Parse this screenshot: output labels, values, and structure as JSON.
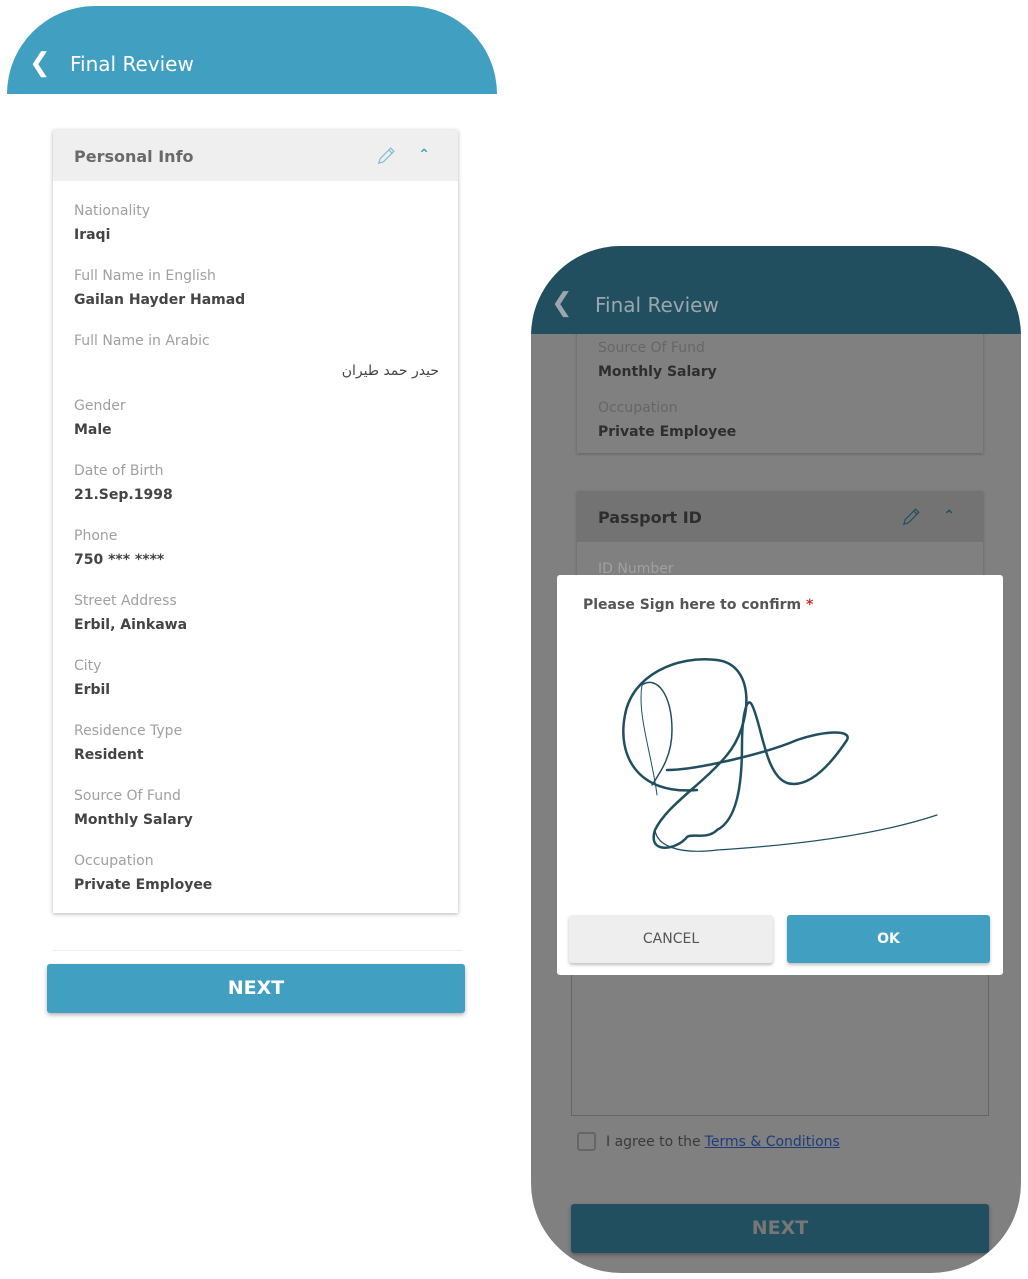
{
  "screen1": {
    "header": {
      "title": "Final Review",
      "back_icon": "chevron-left"
    },
    "section": {
      "title": "Personal Info",
      "edit_icon": "pencil",
      "collapse_icon": "chevron-up"
    },
    "fields": [
      {
        "label": "Nationality",
        "value": "Iraqi"
      },
      {
        "label": "Full Name in English",
        "value": "Gailan Hayder Hamad"
      },
      {
        "label": "Full Name in Arabic",
        "value": "حيدر حمد طيران"
      },
      {
        "label": "Gender",
        "value": "Male"
      },
      {
        "label": "Date of Birth",
        "value": "21.Sep.1998"
      },
      {
        "label": "Phone",
        "value": "750 *** ****"
      },
      {
        "label": "Street Address",
        "value": "Erbil, Ainkawa"
      },
      {
        "label": "City",
        "value": "Erbil"
      },
      {
        "label": "Residence Type",
        "value": "Resident"
      },
      {
        "label": "Source Of Fund",
        "value": "Monthly Salary"
      },
      {
        "label": "Occupation",
        "value": "Private Employee"
      }
    ],
    "next_label": "NEXT"
  },
  "screen2": {
    "header": {
      "title": "Final Review"
    },
    "fields": [
      {
        "label": "Source Of Fund",
        "value": "Monthly Salary"
      },
      {
        "label": "Occupation",
        "value": "Private Employee"
      }
    ],
    "passport": {
      "title": "Passport ID",
      "field_label": "ID Number"
    },
    "agree_text": "I agree to the",
    "terms_link": "Terms & Conditions",
    "next_label": "NEXT",
    "dialog": {
      "prompt": "Please Sign here to confirm",
      "required_mark": "*",
      "cancel_label": "CANCEL",
      "ok_label": "OK"
    }
  },
  "colors": {
    "primary": "#419fc1",
    "dark": "#214f60",
    "overlay": "#808080"
  }
}
